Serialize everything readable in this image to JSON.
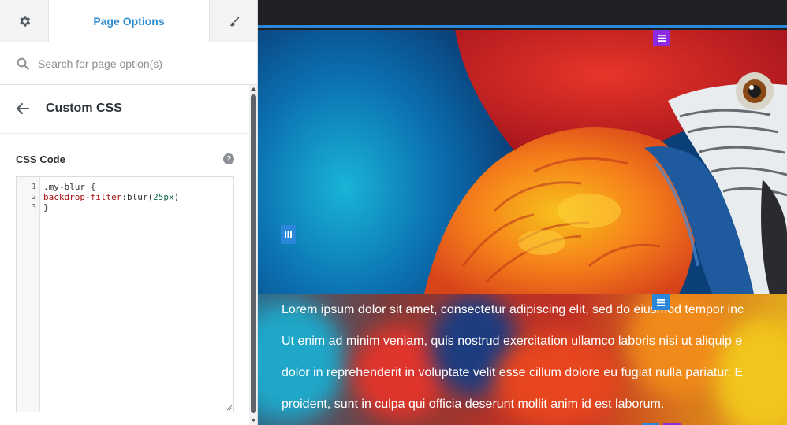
{
  "panel": {
    "tab_title": "Page Options",
    "search_placeholder": "Search for page option(s)",
    "section_title": "Custom CSS",
    "field_label": "CSS Code",
    "help_symbol": "?",
    "code": {
      "line_numbers": [
        "1",
        "2",
        "3"
      ],
      "line1": ".my-blur {",
      "line2_property": "backdrop-filter",
      "line2_colon": ":",
      "line2_func": "blur(",
      "line2_number": "25px",
      "line2_close": ")",
      "line3": "}"
    }
  },
  "preview": {
    "paragraph_lines": [
      "Lorem ipsum dolor sit amet, consectetur adipiscing elit, sed do eiusmod tempor inc",
      "Ut enim ad minim veniam, quis nostrud exercitation ullamco laboris nisi ut aliquip e",
      "dolor in reprehenderit in voluptate velit esse cillum dolore eu fugiat nulla pariatur. E",
      "proident, sunt in culpa qui officia deserunt mollit anim id est laborum."
    ]
  },
  "colors": {
    "accent_blue": "#2e8ccf",
    "section_handle_purple": "#8a2be2",
    "row_handle_blue": "#2b87da",
    "css_property_red": "#aa1111",
    "css_number_green": "#116644"
  },
  "icons": [
    "gear-icon",
    "brush-icon",
    "search-icon",
    "back-arrow-icon",
    "help-icon",
    "menu-icon",
    "columns-icon"
  ]
}
